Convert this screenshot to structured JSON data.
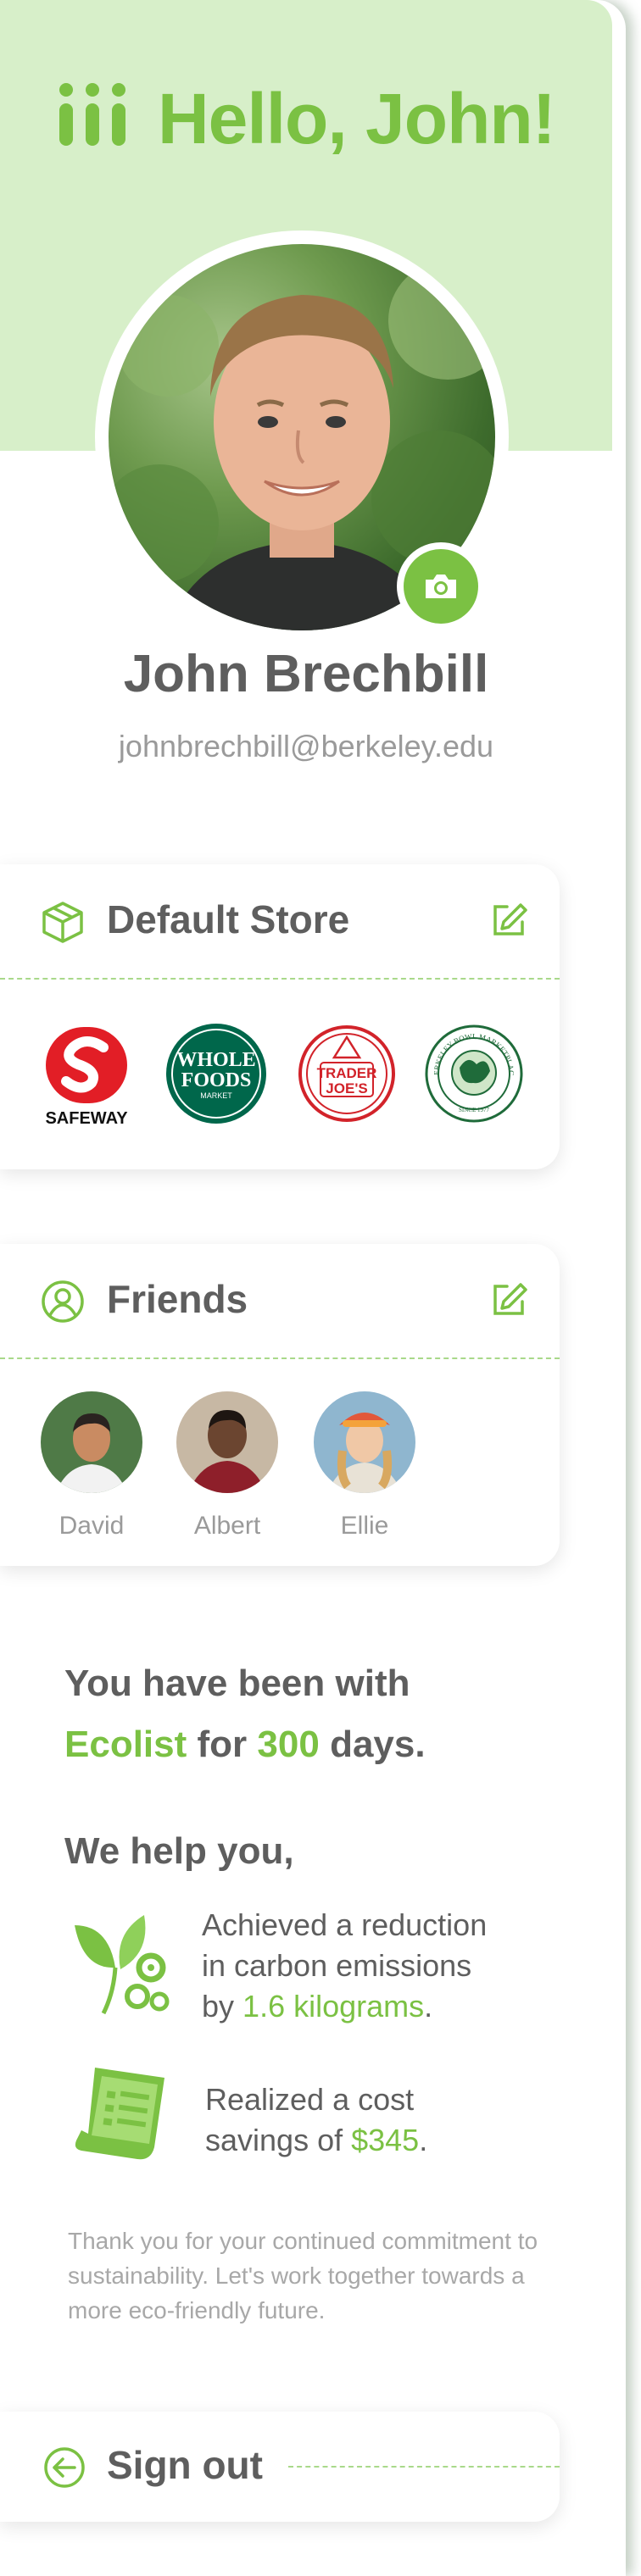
{
  "header": {
    "greeting": "Hello, John!",
    "logo_icon": "ecolist-logo-icon"
  },
  "profile": {
    "name": "John Brechbill",
    "email": "johnbrechbill@berkeley.edu",
    "camera_icon": "camera-icon"
  },
  "default_store": {
    "title": "Default Store",
    "icon": "box-icon",
    "edit_icon": "edit-icon",
    "stores": [
      {
        "name": "SAFEWAY",
        "color": "#e21e26"
      },
      {
        "name_line1": "WHOLE",
        "name_line2": "FOODS",
        "name_line3": "MARKET",
        "color": "#00674b"
      },
      {
        "name_line1": "TRADER",
        "name_line2": "JOE'S",
        "color": "#d2232a"
      },
      {
        "name": "BERKELEY BOWL MARKETPLACE",
        "since": "SINCE 1977",
        "color": "#1f6b3a"
      }
    ]
  },
  "friends": {
    "title": "Friends",
    "icon": "user-circle-icon",
    "edit_icon": "edit-icon",
    "list": [
      {
        "name": "David"
      },
      {
        "name": "Albert"
      },
      {
        "name": "Ellie"
      }
    ]
  },
  "stats": {
    "line1": "You have been with",
    "app_name": "Ecolist",
    "for_text": "for",
    "days": "300",
    "days_suffix": "days.",
    "help_heading": "We help you,",
    "carbon": {
      "line1": "Achieved a reduction",
      "line2": "in carbon emissions",
      "by_text": "by",
      "amount": "1.6 kilograms",
      "period": "."
    },
    "cost": {
      "line1": "Realized a cost",
      "line2_prefix": "savings of",
      "amount": "$345",
      "period": "."
    },
    "thanks": "Thank you for your continued commitment to sustainability. Let's work together towards a more eco-friendly future."
  },
  "signout": {
    "label": "Sign out",
    "icon": "arrow-left-circle-icon"
  },
  "colors": {
    "accent": "#7bc143",
    "header_bg": "#d7efc9",
    "text": "#5e5e5e",
    "muted": "#9a9a9a"
  }
}
